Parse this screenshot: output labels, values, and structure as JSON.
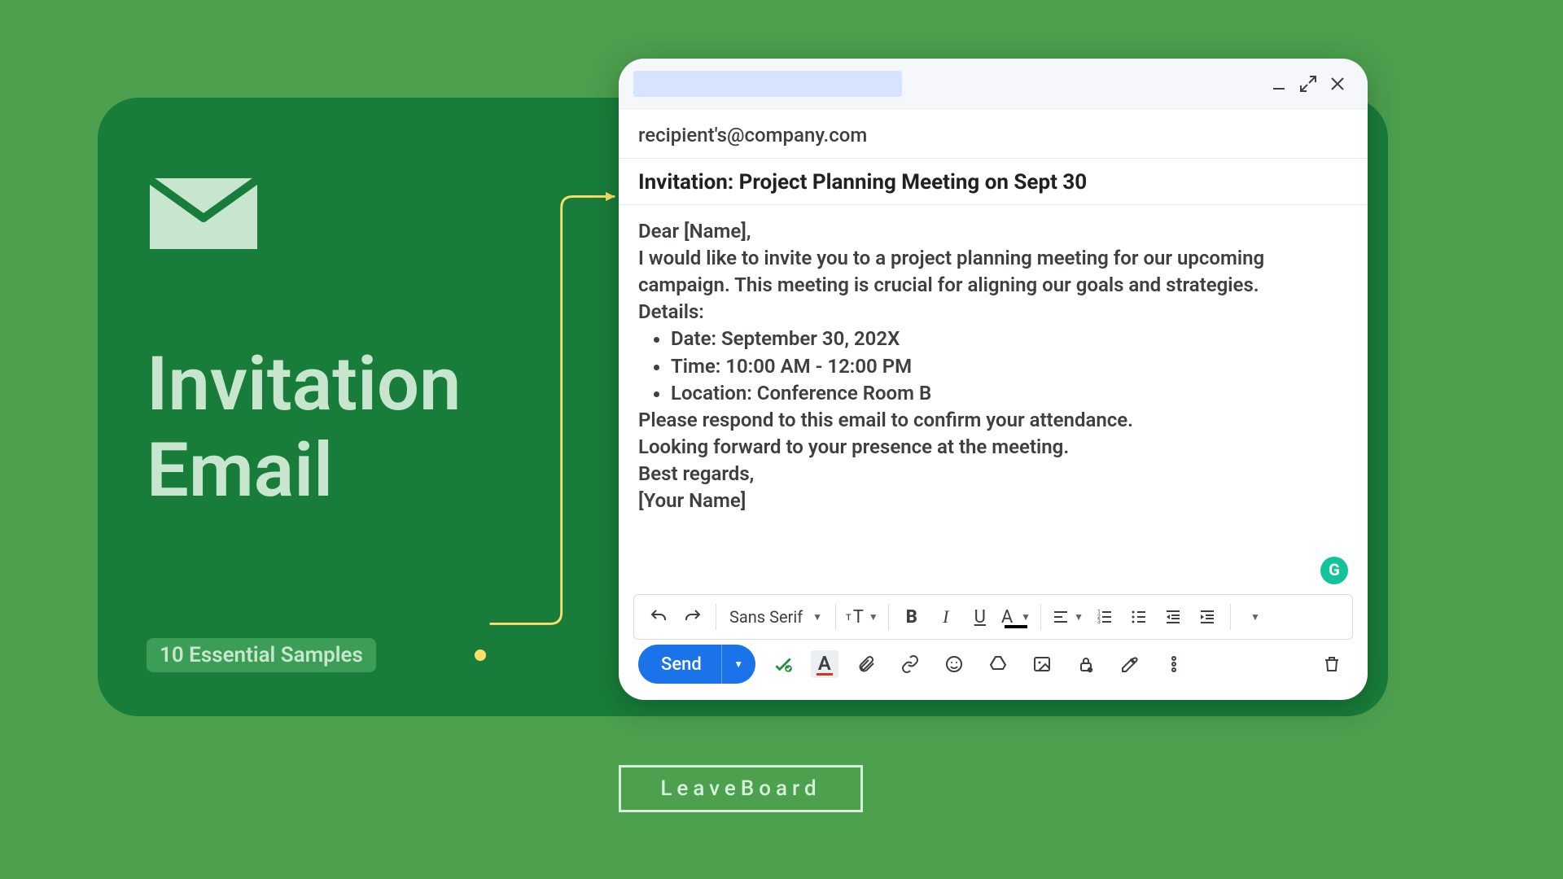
{
  "page": {
    "title_line1": "Invitation",
    "title_line2": "Email",
    "badge": "10 Essential Samples",
    "brand": "LeaveBoard"
  },
  "compose": {
    "recipient": "recipient's@company.com",
    "subject": "Invitation: Project Planning Meeting on Sept 30",
    "body": {
      "greeting": "Dear [Name],",
      "intro": "I would like to invite you to a project planning meeting for our upcoming campaign. This meeting is crucial for aligning our goals and strategies.",
      "details_label": "Details:",
      "items": [
        "Date: September 30, 202X",
        "Time: 10:00 AM - 12:00 PM",
        "Location: Conference Room B"
      ],
      "rsvp": "Please respond to this email to confirm your attendance.",
      "closing1": "Looking forward to your presence at the meeting.",
      "closing2": "Best regards,",
      "signature": "[Your Name]"
    },
    "send_label": "Send",
    "font_label": "Sans Serif"
  }
}
